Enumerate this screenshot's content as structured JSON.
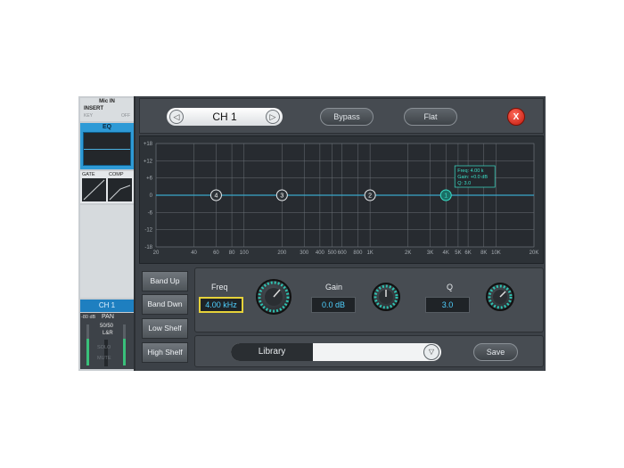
{
  "strip": {
    "input": "Mic IN",
    "insert": "INSERT",
    "key": "KEY",
    "off": "OFF",
    "eq": "EQ",
    "gate": "GATE",
    "comp": "COMP",
    "channel": "CH 1",
    "meter_db": "-80 dB",
    "pan": "PAN",
    "pan_value": "50/50",
    "lr": "L&R",
    "solo": "SOLO",
    "mute": "MUTE"
  },
  "topbar": {
    "prev": "◁",
    "channel": "CH 1",
    "next": "▷",
    "bypass": "Bypass",
    "flat": "Flat",
    "close": "X"
  },
  "graph": {
    "db_ticks": [
      "+18",
      "+12",
      "+6",
      "0",
      "-6",
      "-12",
      "-18"
    ],
    "freq_ticks": [
      "20",
      "40",
      "60",
      "80",
      "100",
      "200",
      "300",
      "400",
      "500",
      "600",
      "800",
      "1K",
      "2K",
      "3K",
      "4K",
      "5K",
      "6K",
      "8K",
      "10K",
      "20K"
    ],
    "bands": [
      {
        "label": "4",
        "freq_hz": 60,
        "gain_db": 0
      },
      {
        "label": "3",
        "freq_hz": 200,
        "gain_db": 0
      },
      {
        "label": "2",
        "freq_hz": 1000,
        "gain_db": 0
      },
      {
        "label": "1",
        "freq_hz": 4000,
        "gain_db": 0,
        "selected": true
      }
    ],
    "tooltip": [
      "Freq: 4.00 k",
      "Gain: +0.0 dB",
      "Q: 3.0"
    ],
    "colors": {
      "curve": "#3aa7c9",
      "band_selected": "#3be0c8"
    }
  },
  "bands": {
    "up": "Band Up",
    "down": "Band Dwn",
    "low_shelf": "Low Shelf",
    "high_shelf": "High Shelf"
  },
  "params": {
    "freq_label": "Freq",
    "freq_value": "4.00 kHz",
    "gain_label": "Gain",
    "gain_value": "0.0 dB",
    "q_label": "Q",
    "q_value": "3.0"
  },
  "library": {
    "label": "Library",
    "dropdown": "▽",
    "save": "Save"
  }
}
